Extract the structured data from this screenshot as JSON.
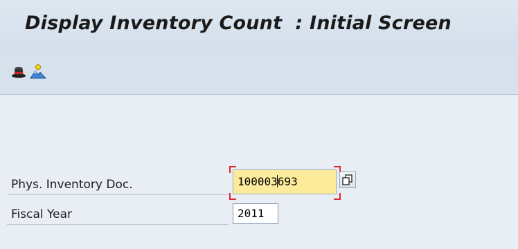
{
  "title": "Display Inventory Count  : Initial Screen",
  "toolbar": {
    "icons": [
      "hat-icon",
      "mountain-image-icon"
    ]
  },
  "fields": {
    "phys_inventory_doc": {
      "label": "Phys. Inventory Doc.",
      "value_before_cursor": "100003",
      "value_after_cursor": "693"
    },
    "fiscal_year": {
      "label": "Fiscal Year",
      "value": "2011"
    }
  },
  "colors": {
    "active_field_bg": "#fdeb9c",
    "focus_bracket": "#e0282b",
    "background": "#e8eef4"
  }
}
